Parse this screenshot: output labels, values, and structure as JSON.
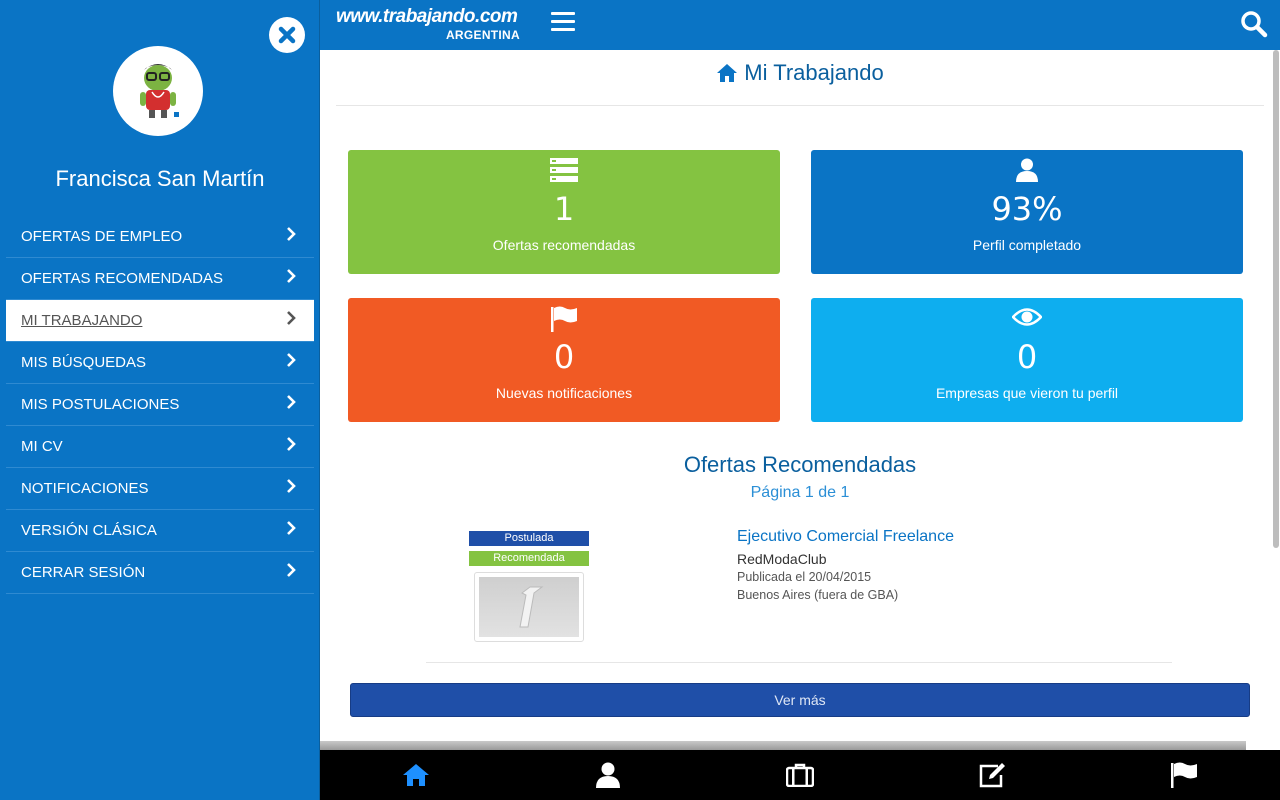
{
  "sidebar": {
    "user_name": "Francisca San Martín",
    "items": [
      {
        "label": "OFERTAS DE EMPLEO"
      },
      {
        "label": "OFERTAS RECOMENDADAS"
      },
      {
        "label": "MI TRABAJANDO",
        "active": true
      },
      {
        "label": "MIS BÚSQUEDAS"
      },
      {
        "label": "MIS POSTULACIONES"
      },
      {
        "label": "MI CV"
      },
      {
        "label": "NOTIFICACIONES"
      },
      {
        "label": "VERSIÓN CLÁSICA"
      },
      {
        "label": "CERRAR SESIÓN"
      }
    ]
  },
  "header": {
    "logo_line1": "www.trabajando.com",
    "logo_line2": "ARGENTINA",
    "icons": [
      "menu-icon",
      "search-icon"
    ]
  },
  "main": {
    "title": "Mi Trabajando",
    "cards": {
      "ofertas": {
        "value": "1",
        "label": "Ofertas recomendadas",
        "color": "#84c341",
        "icon": "server-icon"
      },
      "perfil": {
        "value": "93%",
        "label": "Perfil completado",
        "color": "#0a74c5",
        "icon": "user-icon"
      },
      "notif": {
        "value": "0",
        "label": "Nuevas notificaciones",
        "color": "#f15a24",
        "icon": "flag-icon"
      },
      "empresas": {
        "value": "0",
        "label": "Empresas que vieron tu perfil",
        "color": "#0eaeef",
        "icon": "eye-icon"
      }
    },
    "recommended": {
      "title": "Ofertas Recomendadas",
      "pagination": "Página 1 de 1",
      "job": {
        "badge_applied": "Postulada",
        "badge_recommended": "Recomendada",
        "title": "Ejecutivo Comercial Freelance",
        "company": "RedModaClub",
        "published": "Publicada el 20/04/2015",
        "location": "Buenos Aires (fuera de GBA)"
      },
      "more_button": "Ver más"
    }
  },
  "bottom_nav": [
    "home-icon",
    "user-icon",
    "briefcase-icon",
    "edit-icon",
    "flag-icon"
  ],
  "colors": {
    "brand": "#0a74c5",
    "green": "#84c341",
    "orange": "#f15a24",
    "cyan": "#0eaeef",
    "navy": "#1f4fa8"
  }
}
